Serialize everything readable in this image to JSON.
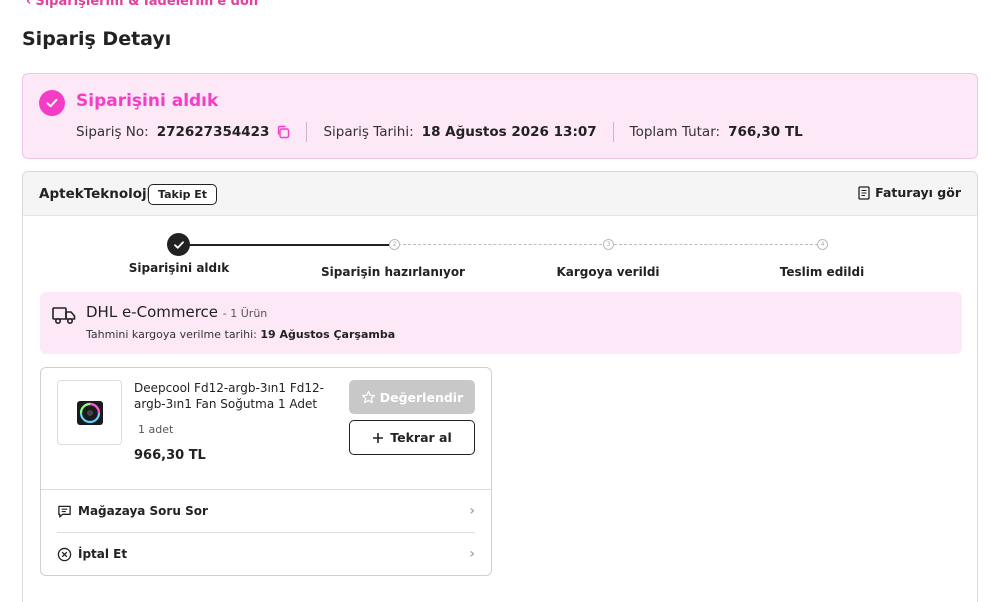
{
  "nav": {
    "back_label": "Siparişlerim & İadelerim'e dön"
  },
  "page": {
    "title": "Sipariş Detayı"
  },
  "status": {
    "title": "Siparişini aldık",
    "order_no_label": "Sipariş No:",
    "order_no": "272627354423",
    "order_date_label": "Sipariş Tarihi:",
    "order_date": "18 Ağustos 2026 13:07",
    "total_label": "Toplam Tutar:",
    "total": "766,30 TL",
    "accent_color": "#f53cc7"
  },
  "seller": {
    "name": "AptekTeknoloji",
    "follow_label": "Takip Et",
    "invoice_label": "Faturayı gör"
  },
  "stepper": {
    "steps": [
      {
        "label": "Siparişini aldık",
        "number": "",
        "done": true
      },
      {
        "label": "Siparişin hazırlanıyor",
        "number": "2",
        "done": false
      },
      {
        "label": "Kargoya verildi",
        "number": "3",
        "done": false
      },
      {
        "label": "Teslim edildi",
        "number": "4",
        "done": false
      }
    ]
  },
  "cargo": {
    "carrier": "DHL e-Commerce",
    "item_count": "- 1 Ürün",
    "estimate_label": "Tahmini kargoya verilme tarihi:",
    "estimate_date": "19 Ağustos Çarşamba"
  },
  "product": {
    "name": "Deepcool Fd12-argb-3ın1 Fd12-argb-3ın1 Fan Soğutma 1 Adet",
    "quantity": "1 adet",
    "price": "966,30 TL",
    "review_label": "Değerlendir",
    "reorder_label": "Tekrar al",
    "thumb_icon": "fan-product-image"
  },
  "actions": {
    "ask_seller_label": "Mağazaya Soru Sor",
    "cancel_label": "İptal Et"
  }
}
